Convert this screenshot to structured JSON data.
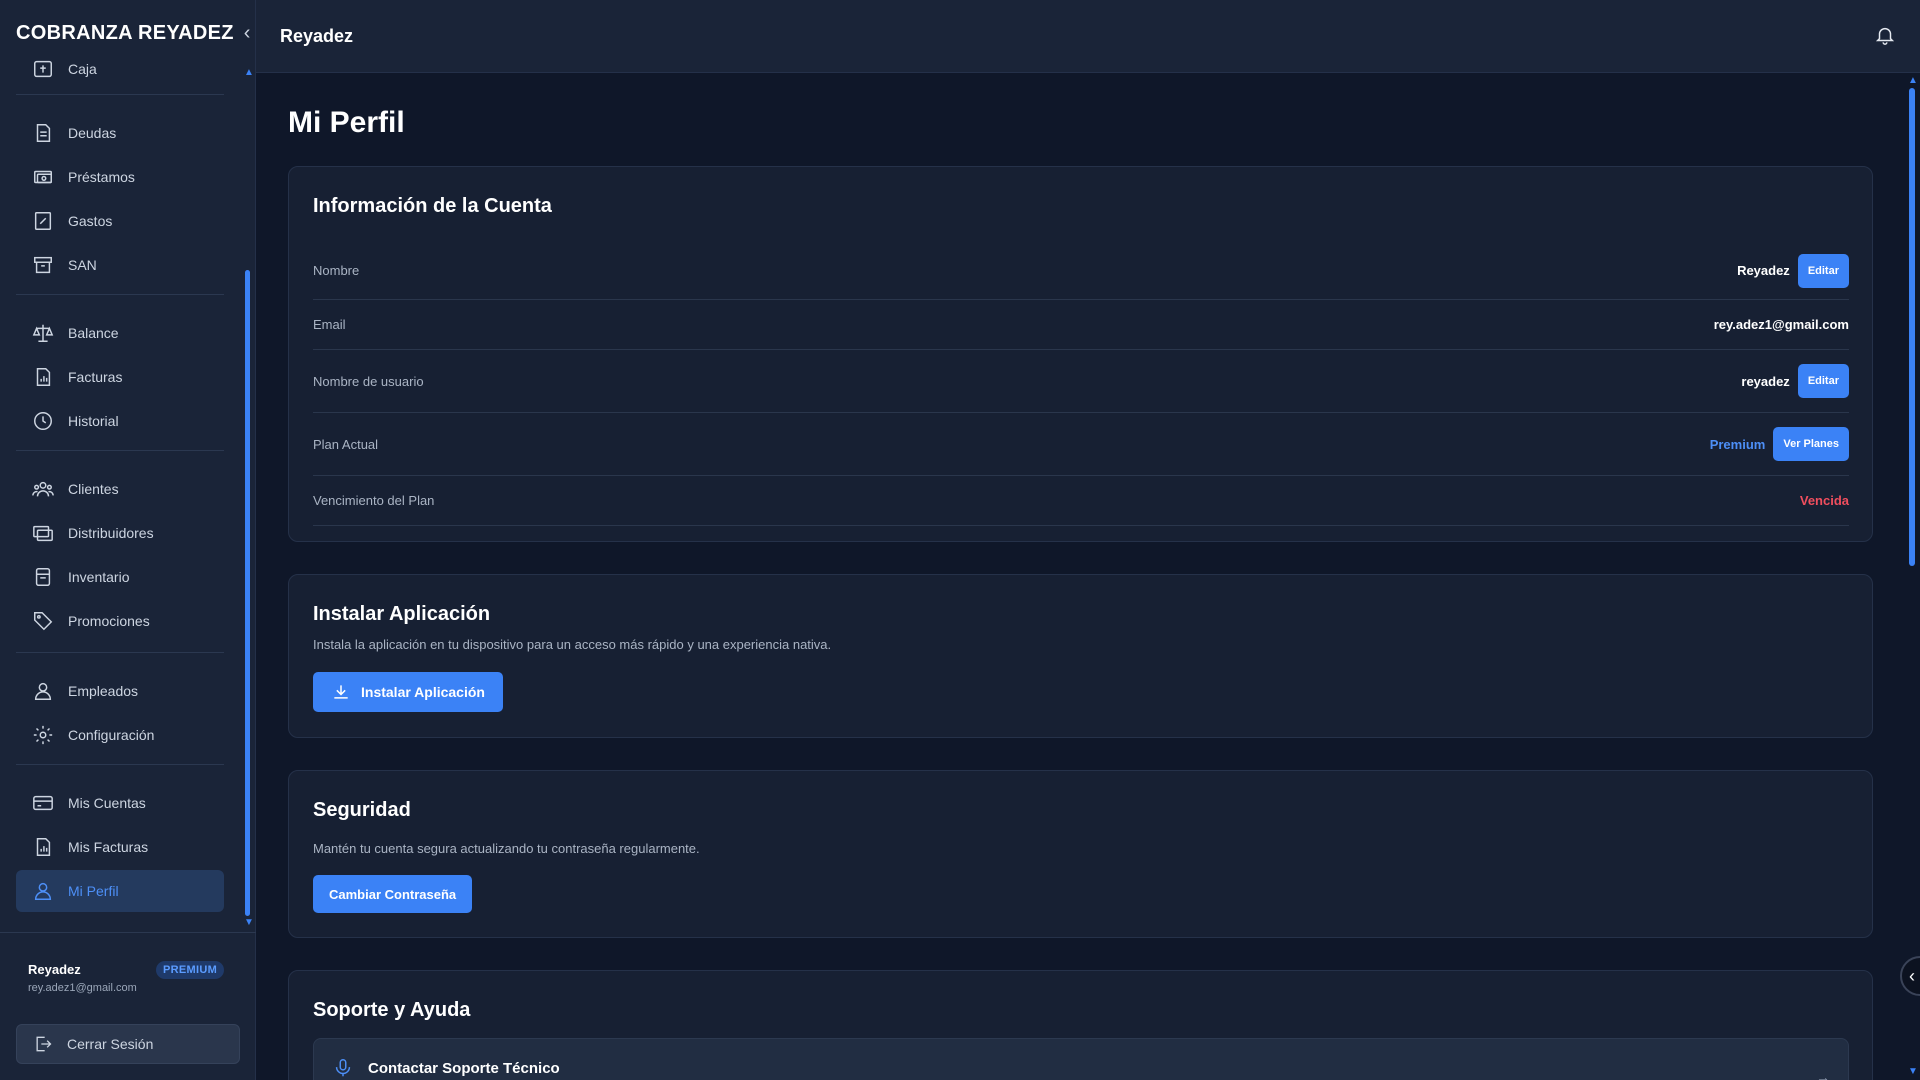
{
  "sidebar": {
    "brand": "COBRANZA REYADEZ",
    "partial_item": "Caja",
    "items": [
      {
        "label": "Deudas",
        "icon": "document-icon"
      },
      {
        "label": "Préstamos",
        "icon": "money-icon"
      },
      {
        "label": "Gastos",
        "icon": "receipt-icon"
      },
      {
        "label": "SAN",
        "icon": "archive-icon"
      },
      {
        "label": "Balance",
        "icon": "scale-icon"
      },
      {
        "label": "Facturas",
        "icon": "invoice-chart-icon"
      },
      {
        "label": "Historial",
        "icon": "clock-icon"
      },
      {
        "label": "Clientes",
        "icon": "users-icon"
      },
      {
        "label": "Distribuidores",
        "icon": "cards-icon"
      },
      {
        "label": "Inventario",
        "icon": "box-icon"
      },
      {
        "label": "Promociones",
        "icon": "tag-icon"
      },
      {
        "label": "Empleados",
        "icon": "user-icon"
      },
      {
        "label": "Configuración",
        "icon": "gear-icon"
      },
      {
        "label": "Mis Cuentas",
        "icon": "credit-card-icon"
      },
      {
        "label": "Mis Facturas",
        "icon": "invoice-chart-icon"
      },
      {
        "label": "Mi Perfil",
        "icon": "user-icon"
      }
    ],
    "active_item": "Mi Perfil",
    "user": {
      "name": "Reyadez",
      "email": "rey.adez1@gmail.com",
      "badge": "PREMIUM"
    },
    "logout_label": "Cerrar Sesión"
  },
  "header": {
    "title": "Reyadez"
  },
  "main": {
    "page_title": "Mi Perfil",
    "account": {
      "title": "Información de la Cuenta",
      "rows": [
        {
          "label": "Nombre",
          "value": "Reyadez",
          "button": "Editar"
        },
        {
          "label": "Email",
          "value": "rey.adez1@gmail.com"
        },
        {
          "label": "Nombre de usuario",
          "value": "reyadez",
          "button": "Editar"
        },
        {
          "label": "Plan Actual",
          "value": "Premium",
          "button": "Ver Planes"
        },
        {
          "label": "Vencimiento del Plan",
          "value": "Vencida"
        }
      ]
    },
    "install": {
      "title": "Instalar Aplicación",
      "description": "Instala la aplicación en tu dispositivo para un acceso más rápido y una experiencia nativa.",
      "button": "Instalar Aplicación"
    },
    "security": {
      "title": "Seguridad",
      "description": "Mantén tu cuenta segura actualizando tu contraseña regularmente.",
      "button": "Cambiar Contraseña"
    },
    "support": {
      "title": "Soporte y Ayuda",
      "item": "Contactar Soporte Técnico"
    }
  },
  "colors": {
    "accent": "#3b82f6",
    "background": "#0f1729",
    "panel": "#1a2438",
    "card": "#172033",
    "danger": "#f04e5e"
  }
}
